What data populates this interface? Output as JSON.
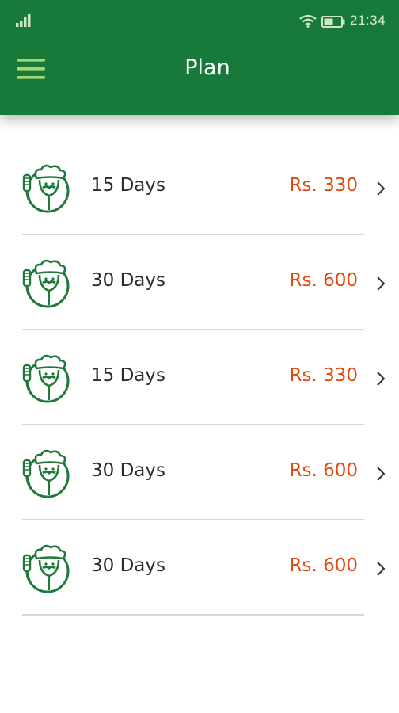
{
  "status_bar": {
    "time": "21:34",
    "icons": [
      "signal-icon",
      "wifi-icon",
      "battery-icon"
    ]
  },
  "app_bar": {
    "title": "Plan",
    "menu_icon": "hamburger-menu-icon"
  },
  "colors": {
    "primary": "#177a3a",
    "price": "#e04a10",
    "text": "#2b2b2b",
    "divider": "#d8d8d8"
  },
  "plans": [
    {
      "duration": "15 Days",
      "price": "Rs. 330"
    },
    {
      "duration": "30 Days",
      "price": "Rs. 600"
    },
    {
      "duration": "15 Days",
      "price": "Rs. 330"
    },
    {
      "duration": "30 Days",
      "price": "Rs. 600"
    },
    {
      "duration": "30 Days",
      "price": "Rs. 600"
    }
  ]
}
